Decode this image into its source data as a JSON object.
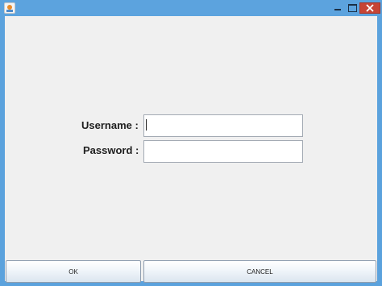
{
  "window": {
    "icon": "java-icon",
    "controls": [
      "minimize-icon",
      "maximize-icon",
      "close-icon"
    ],
    "close_color": "#c64435",
    "frame_color": "#5ca3de"
  },
  "form": {
    "username_label": "Username :",
    "password_label": "Password :",
    "username_value": "",
    "password_value": ""
  },
  "buttons": {
    "ok_label": "OK",
    "cancel_label": "CANCEL"
  }
}
